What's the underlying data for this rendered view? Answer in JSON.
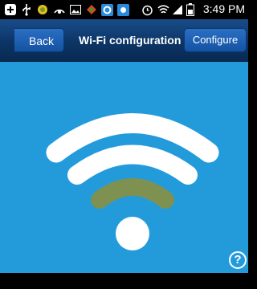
{
  "status_bar": {
    "time": "3:49 PM",
    "icons": [
      "add-icon",
      "usb-icon",
      "app-icon",
      "network-icon",
      "image-icon",
      "app-icon",
      "app-icon",
      "app-icon",
      "alarm-icon",
      "wifi-icon",
      "signal-icon",
      "battery-icon"
    ]
  },
  "nav": {
    "back_label": "Back",
    "title": "Wi-Fi configuration",
    "configure_label": "Configure"
  },
  "wifi": {
    "active_color": "#ffffff",
    "weak_bar_color": "#7f9150",
    "background": "#239bdb"
  },
  "help": {
    "label": "?"
  }
}
